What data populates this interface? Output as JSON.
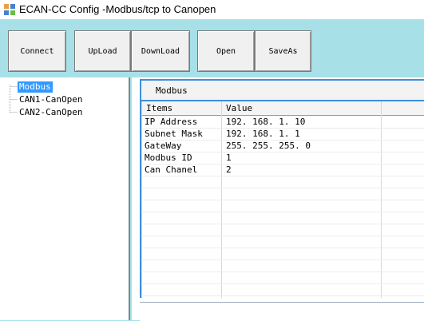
{
  "window": {
    "title": "ECAN-CC Config -Modbus/tcp to Canopen",
    "icon": "app-grid-icon"
  },
  "toolbar": {
    "buttons": [
      {
        "label": "Connect"
      },
      {
        "label": "UpLoad"
      },
      {
        "label": "DownLoad"
      },
      {
        "label": "Open"
      },
      {
        "label": "SaveAs"
      }
    ]
  },
  "tree": {
    "items": [
      {
        "label": "Modbus",
        "selected": true
      },
      {
        "label": "CAN1-CanOpen",
        "selected": false
      },
      {
        "label": "CAN2-CanOpen",
        "selected": false
      }
    ]
  },
  "panel": {
    "title": "Modbus",
    "columns": [
      "Items",
      "Value"
    ],
    "rows": [
      {
        "item": "IP Address",
        "value": "192. 168. 1. 10"
      },
      {
        "item": "Subnet Mask",
        "value": "192. 168. 1. 1"
      },
      {
        "item": "GateWay",
        "value": "255. 255. 255. 0"
      },
      {
        "item": "Modbus ID",
        "value": "1"
      },
      {
        "item": "Can Chanel",
        "value": "2"
      }
    ]
  },
  "colors": {
    "background": "#a8e0e8",
    "selection": "#3399ff",
    "panel_frame": "#3d8fdc"
  }
}
